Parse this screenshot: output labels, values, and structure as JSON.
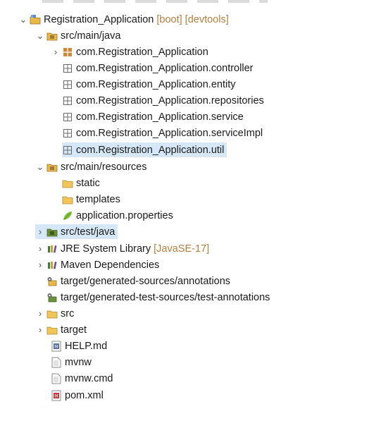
{
  "tree": {
    "project": {
      "label": "Registration_Application",
      "decoration": "[boot] [devtools]",
      "icon": "spring-project-icon"
    },
    "src_main_java": {
      "label": "src/main/java",
      "icon": "source-folder-icon",
      "packages": [
        {
          "label": "com.Registration_Application",
          "icon": "package-icon",
          "expandable": true
        },
        {
          "label": "com.Registration_Application.controller",
          "icon": "package-icon"
        },
        {
          "label": "com.Registration_Application.entity",
          "icon": "package-icon"
        },
        {
          "label": "com.Registration_Application.repositories",
          "icon": "package-icon"
        },
        {
          "label": "com.Registration_Application.service",
          "icon": "package-icon"
        },
        {
          "label": "com.Registration_Application.serviceImpl",
          "icon": "package-icon"
        },
        {
          "label": "com.Registration_Application.util",
          "icon": "package-icon",
          "selected": true
        }
      ]
    },
    "src_main_resources": {
      "label": "src/main/resources",
      "icon": "source-folder-icon",
      "children": [
        {
          "label": "static",
          "icon": "folder-icon"
        },
        {
          "label": "templates",
          "icon": "folder-icon"
        },
        {
          "label": "application.properties",
          "icon": "spring-leaf-icon"
        }
      ]
    },
    "src_test_java": {
      "label": "src/test/java",
      "icon": "test-source-folder-icon"
    },
    "jre": {
      "label": "JRE System Library",
      "decoration": "[JavaSE-17]",
      "icon": "library-icon"
    },
    "maven": {
      "label": "Maven Dependencies",
      "icon": "library-icon"
    },
    "gen_sources": {
      "label": "target/generated-sources/annotations",
      "icon": "generated-folder-icon"
    },
    "gen_test_sources": {
      "label": "target/generated-test-sources/test-annotations",
      "icon": "generated-folder-icon"
    },
    "src": {
      "label": "src",
      "icon": "folder-icon"
    },
    "target": {
      "label": "target",
      "icon": "folder-icon"
    },
    "help": {
      "label": "HELP.md",
      "icon": "markdown-file-icon"
    },
    "mvnw": {
      "label": "mvnw",
      "icon": "file-icon"
    },
    "mvnw_cmd": {
      "label": "mvnw.cmd",
      "icon": "file-icon"
    },
    "pom": {
      "label": "pom.xml",
      "icon": "maven-pom-icon"
    }
  },
  "colors": {
    "selection": "#d6e8f7",
    "decoration": "#b37f3c",
    "folder": "#e8b84a",
    "package": "#8a6d3b",
    "library": "#3d7a3a"
  }
}
